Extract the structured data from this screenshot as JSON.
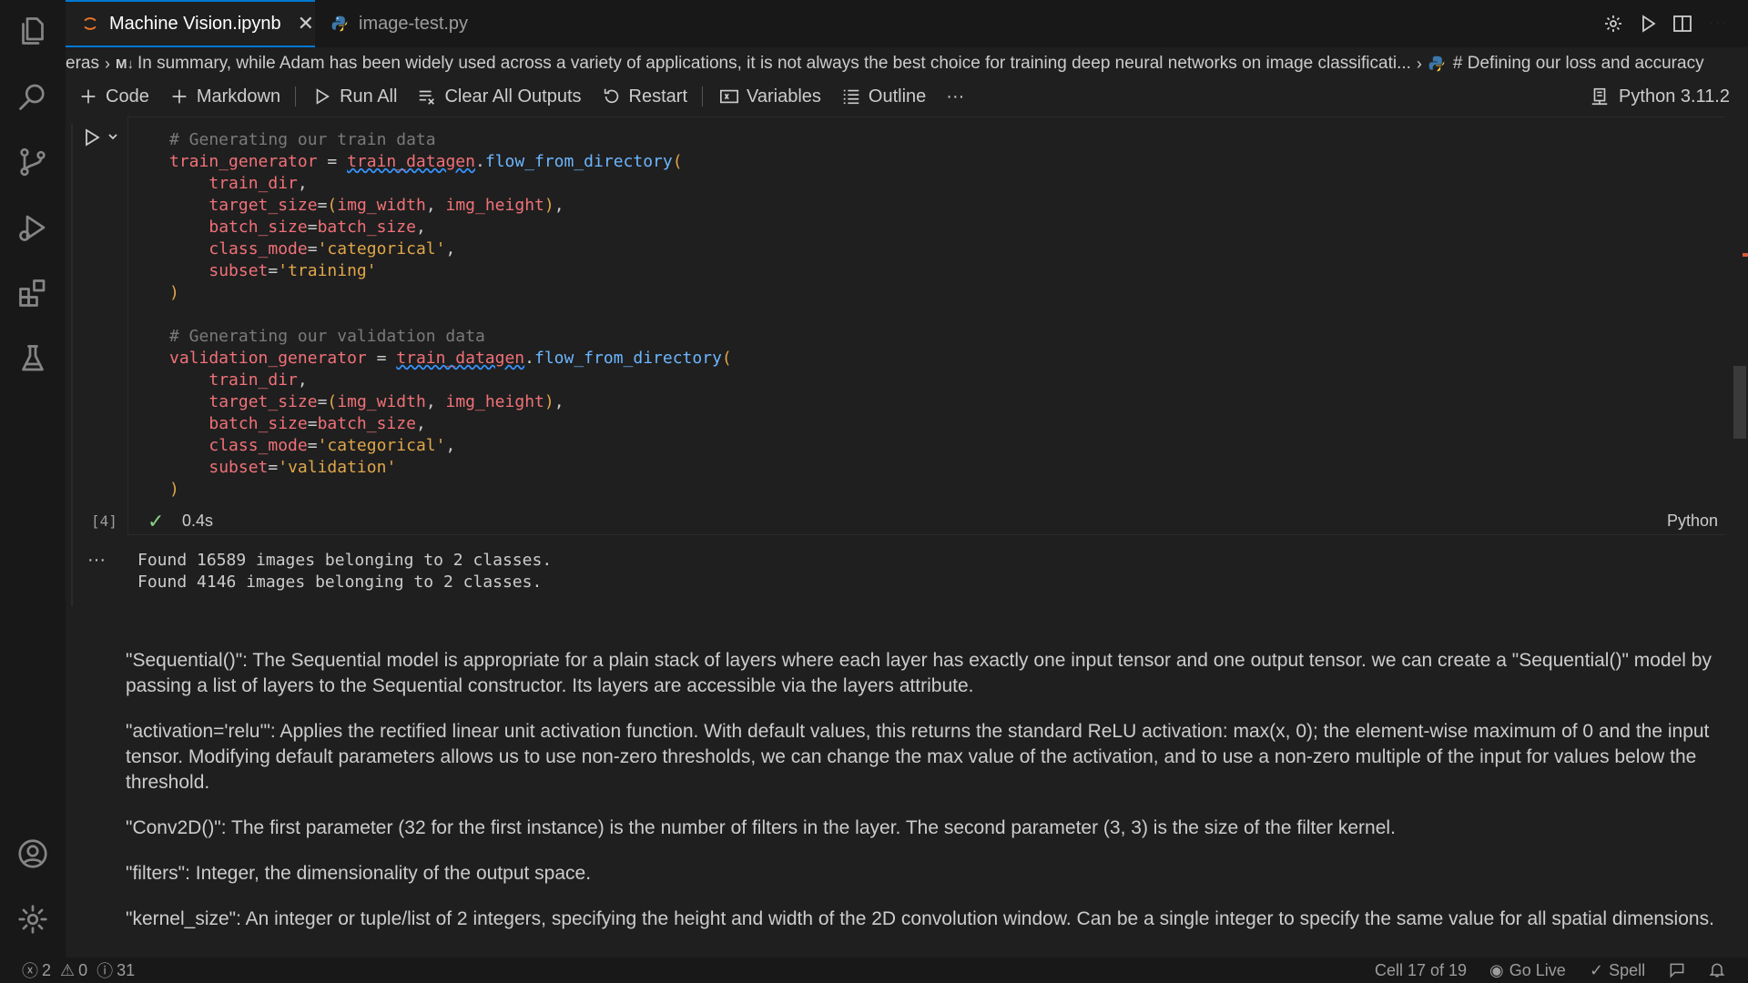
{
  "tabs": [
    {
      "label": "Machine Vision.ipynb",
      "close": "✕"
    },
    {
      "label": "image-test.py"
    }
  ],
  "breadcrumb": {
    "prefix": "eras",
    "md_badge": "M↓",
    "cell_text": "In summary, while Adam has been widely used across a variety of applications, it is not always the best choice for training deep neural networks on  image classificati...",
    "code_cell": "# Defining our loss and accuracy"
  },
  "toolbar": {
    "code": "Code",
    "markdown": "Markdown",
    "run_all": "Run All",
    "clear_outputs": "Clear All Outputs",
    "restart": "Restart",
    "variables": "Variables",
    "outline": "Outline",
    "more": "···",
    "kernel": "Python 3.11.2"
  },
  "cell": {
    "exec_count": "[4]",
    "check": "✓",
    "time": "0.4s",
    "language": "Python",
    "output_dots": "···",
    "output_lines": [
      "Found 16589 images belonging to 2 classes.",
      "Found 4146 images belonging to 2 classes."
    ]
  },
  "code": {
    "c1": "# Generating our train data",
    "v1": "train_generator",
    "eq": " = ",
    "obj": "train_datagen",
    "dot": ".",
    "fn": "flow_from_directory",
    "open": "(",
    "a_train_dir": "train_dir",
    "comma": ",",
    "a_target": "target_size",
    "eq2": "=",
    "lp": "(",
    "a_w": "img_width",
    "sep": ", ",
    "a_h": "img_height",
    "rp": ")",
    "a_batch": "batch_size",
    "a_batch_v": "batch_size",
    "a_class": "class_mode",
    "s_cat": "'categorical'",
    "a_subset": "subset",
    "s_training": "'training'",
    "close": ")",
    "c2": "# Generating our validation data",
    "v2": "validation_generator",
    "s_validation": "'validation'"
  },
  "markdown": [
    "\"Sequential()\": The Sequential model is appropriate for a plain stack of layers where each layer has exactly one input tensor and one output tensor. we can create a \"Sequential()\" model by passing a list of layers to the Sequential constructor. Its layers are accessible via the layers attribute.",
    "\"activation='relu'\": Applies the rectified linear unit activation function. With default values, this returns the standard ReLU activation: max(x, 0); the element-wise maximum of 0 and the input tensor. Modifying default parameters allows us to use non-zero thresholds, we can change the max value of the activation, and to use a non-zero multiple of the input for values below the threshold.",
    "\"Conv2D()\": The first parameter (32 for the first instance) is the number of filters in the layer. The second parameter (3, 3) is the size of the filter kernel.",
    "\"filters\": Integer, the dimensionality of the output space.",
    "\"kernel_size\": An integer or tuple/list of 2 integers, specifying the height and width of the 2D convolution window. Can be a single integer to specify the same value for all spatial dimensions."
  ],
  "status": {
    "errors": "2",
    "warnings": "0",
    "info": "31",
    "cell_pos": "Cell 17 of 19",
    "go_live": "Go Live",
    "spell": "Spell"
  },
  "icons": [
    "explorer-icon",
    "search-icon",
    "source-control-icon",
    "run-debug-icon",
    "extensions-icon",
    "testing-icon",
    "account-icon",
    "settings-gear-icon"
  ],
  "colors": {
    "accent": "#0078d4",
    "success": "#89d185",
    "variable": "#f07178",
    "function": "#6cb6ff",
    "string": "#e0a64a"
  }
}
